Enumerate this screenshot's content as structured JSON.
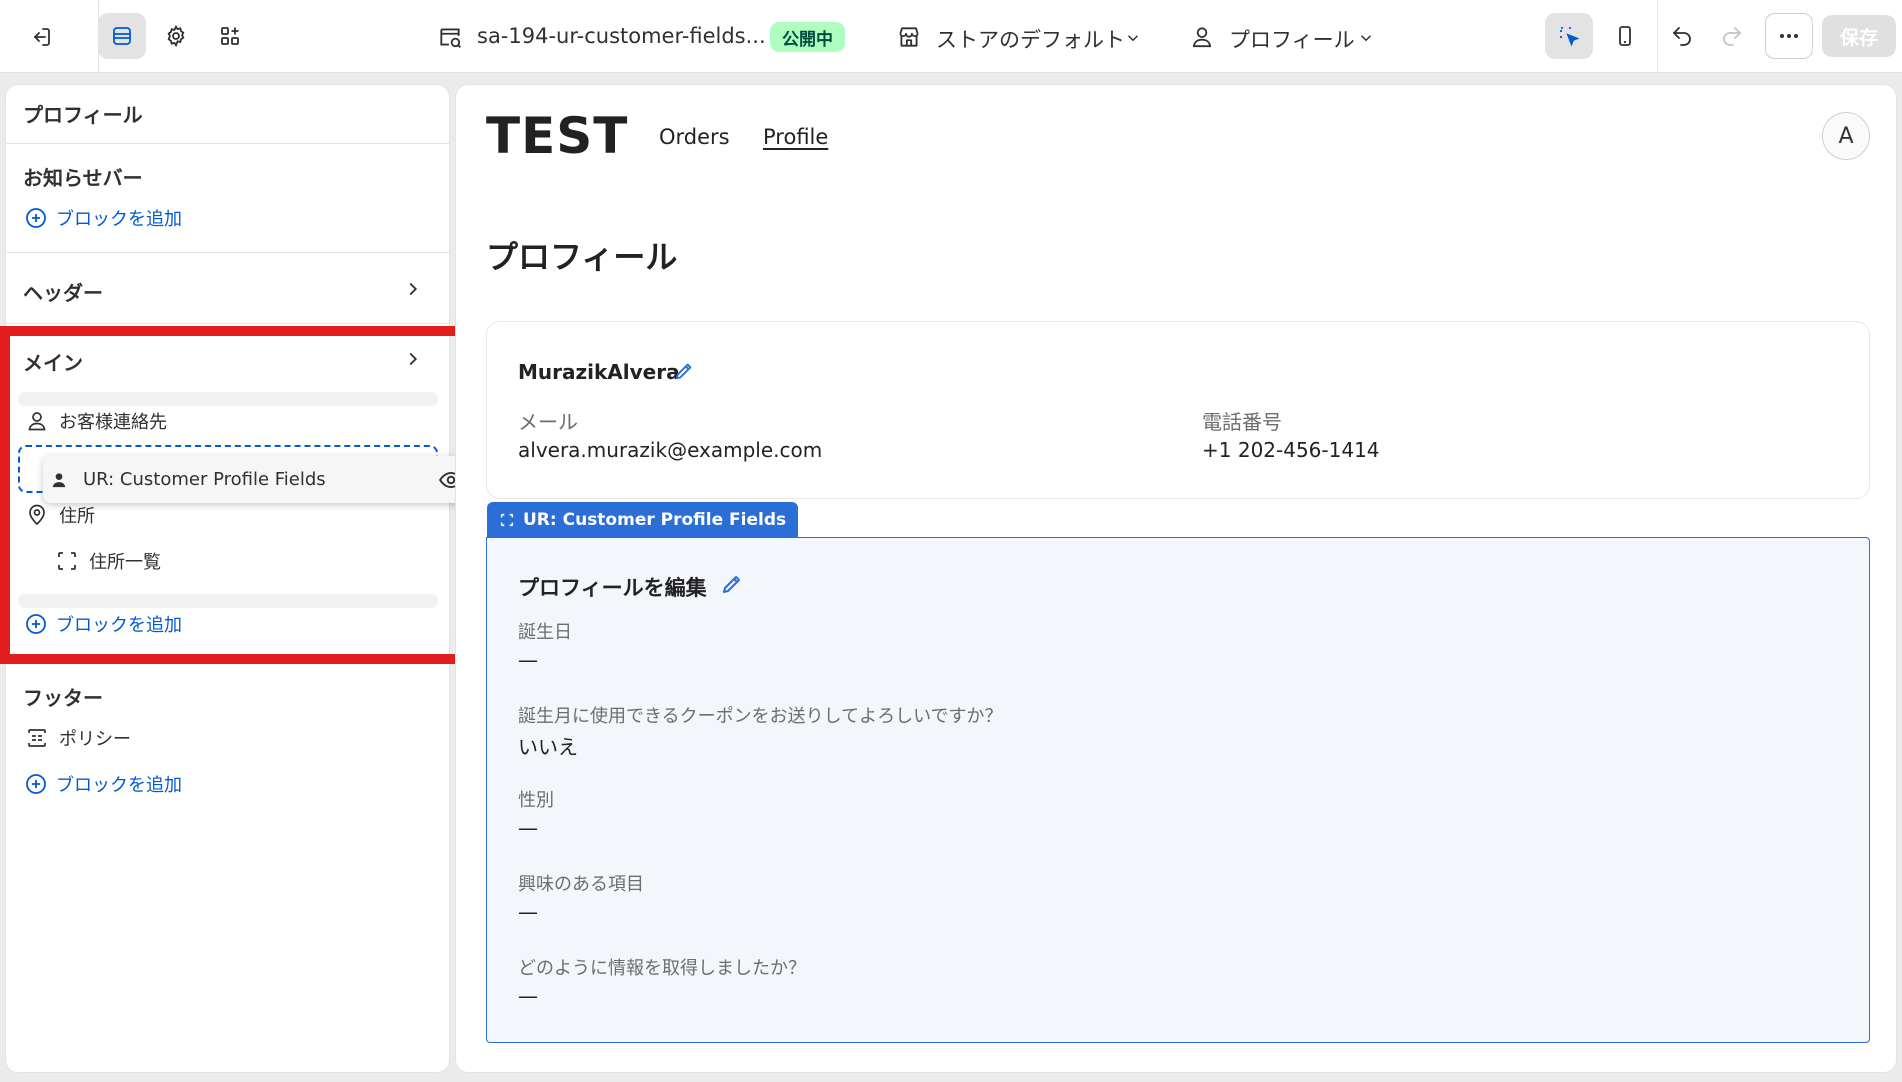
{
  "topbar": {
    "theme_name": "sa-194-ur-customer-fields...",
    "status_badge": "公開中",
    "store_selector": "ストアのデフォルト",
    "page_selector": "プロフィール",
    "save_label": "保存"
  },
  "sidebar": {
    "title": "プロフィール",
    "announcement": {
      "heading": "お知らせバー",
      "add_block": "ブロックを追加"
    },
    "header": {
      "heading": "ヘッダー"
    },
    "main": {
      "heading": "メイン",
      "items": [
        {
          "label": "お客様連絡先",
          "icon": "person-icon"
        },
        {
          "label": "住所",
          "icon": "location-pin-icon"
        },
        {
          "label": "住所一覧",
          "icon": "section-frame-icon"
        }
      ],
      "dragging_block": "UR: Customer Profile Fields",
      "add_block": "ブロックを追加"
    },
    "footer": {
      "heading": "フッター",
      "items": [
        {
          "label": "ポリシー",
          "icon": "policy-icon"
        }
      ],
      "add_block": "ブロックを追加"
    }
  },
  "preview": {
    "store_logo": "TEST",
    "nav": [
      "Orders",
      "Profile"
    ],
    "avatar_initial": "A",
    "page_title": "プロフィール",
    "customer": {
      "name": "MurazikAlvera",
      "email_label": "メール",
      "email_value": "alvera.murazik@example.com",
      "phone_label": "電話番号",
      "phone_value": "+1 202-456-1414"
    },
    "selected_block_tab": "UR: Customer Profile Fields",
    "edit_profile": {
      "title": "プロフィールを編集",
      "fields": [
        {
          "label": "誕生日",
          "value": "—"
        },
        {
          "label": "誕生月に使用できるクーポンをお送りしてよろしいですか？",
          "value": "いいえ"
        },
        {
          "label": "性別",
          "value": "—"
        },
        {
          "label": "興味のある項目",
          "value": "—"
        },
        {
          "label": "どのように情報を取得しましたか？",
          "value": "—"
        }
      ]
    }
  },
  "colors": {
    "accent": "#005bd3",
    "selection_blue": "#2b6fd6",
    "highlight_red": "#e21d1d",
    "live_badge_bg": "#affebf"
  }
}
